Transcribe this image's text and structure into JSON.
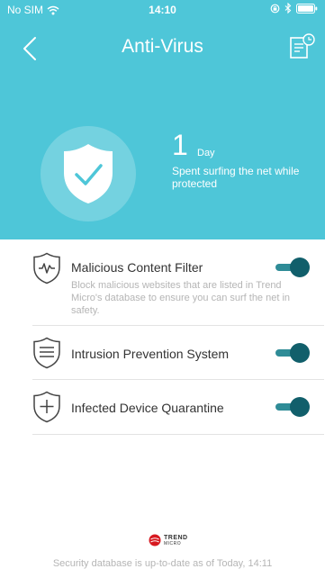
{
  "status_bar": {
    "carrier": "No SIM",
    "time": "14:10"
  },
  "header": {
    "title": "Anti-Virus"
  },
  "summary": {
    "days_count": "1",
    "days_unit": "Day",
    "description": "Spent surfing the net while protected"
  },
  "features": [
    {
      "label": "Malicious Content Filter",
      "description": "Block malicious websites that are listed in Trend Micro's database to ensure you can surf the net in safety.",
      "enabled": true,
      "icon": "pulse-shield-icon"
    },
    {
      "label": "Intrusion Prevention System",
      "description": "",
      "enabled": true,
      "icon": "firewall-shield-icon"
    },
    {
      "label": "Infected Device Quarantine",
      "description": "",
      "enabled": true,
      "icon": "plus-shield-icon"
    }
  ],
  "brand": {
    "line1": "TREND",
    "line2": "MICRO"
  },
  "footer": {
    "text": "Security database is up-to-date as of Today, 14:11"
  },
  "colors": {
    "hero": "#4ec6d8",
    "toggle_track": "#2f8c97",
    "toggle_knob": "#115f6b",
    "footer_text": "#b5b5b5",
    "brand_red": "#d71920"
  }
}
